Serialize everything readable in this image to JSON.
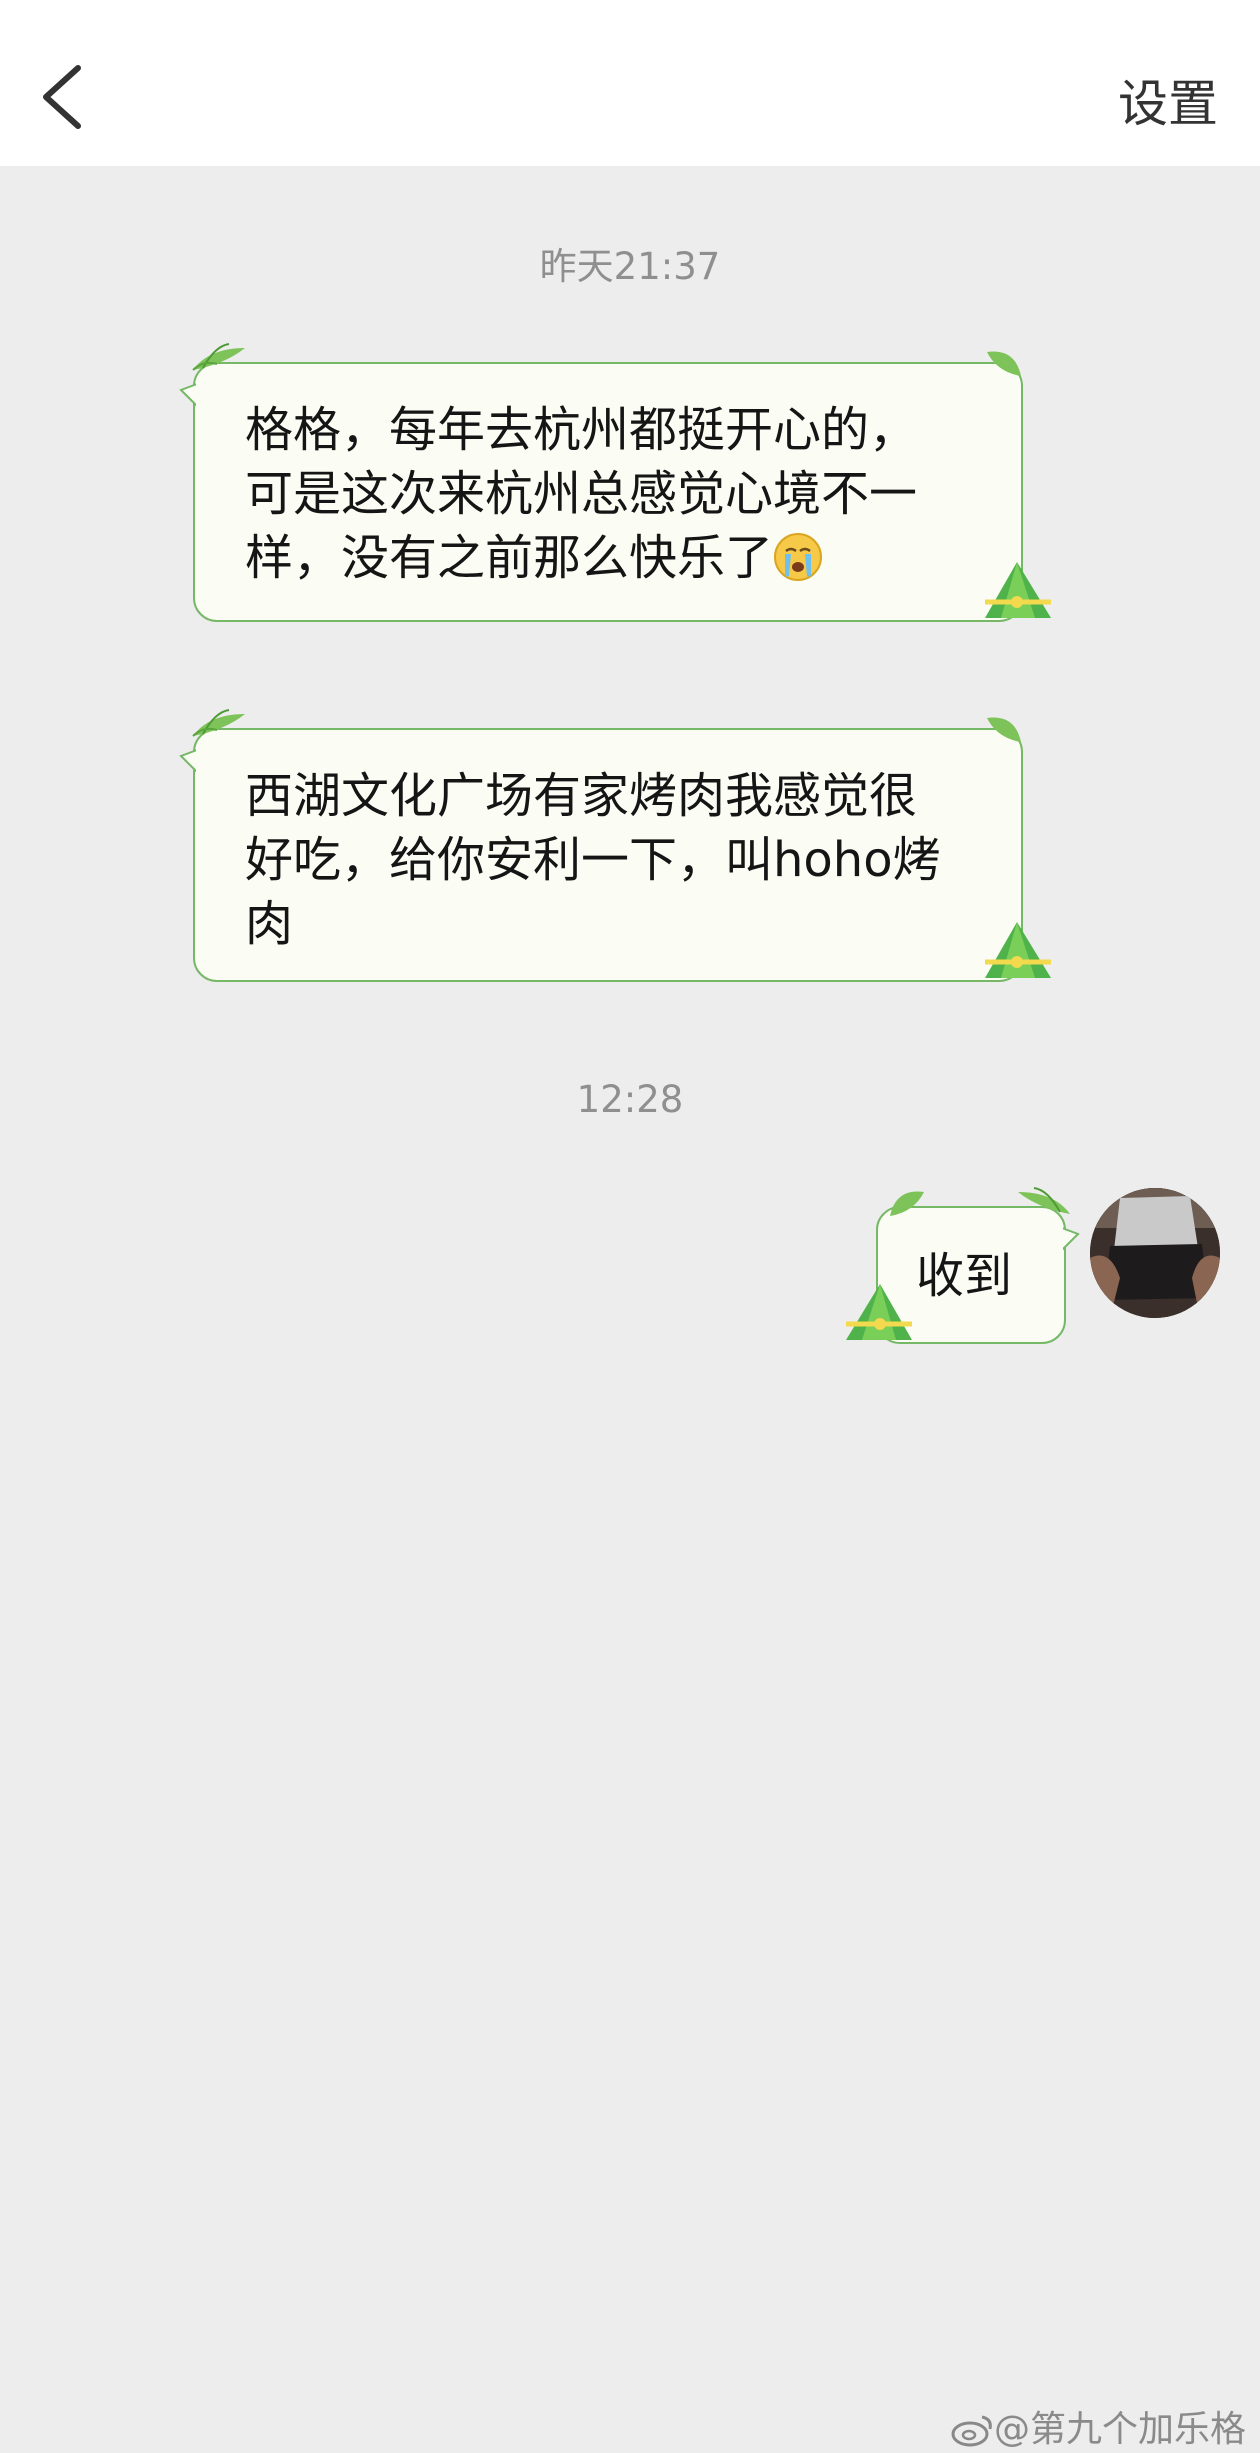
{
  "header": {
    "back_icon": "chevron-left-icon",
    "title": "",
    "settings_label": "设置"
  },
  "messages": {
    "timestamp_1": "昨天21:37",
    "msg1": {
      "line1": "格格，每年去杭州都挺开心的，",
      "line2": "可是这次来杭州总感觉心境不一",
      "line3": "样，没有之前那么快乐了",
      "emoji": "crying-face-icon"
    },
    "msg2": {
      "line1": "西湖文化广场有家烤肉我感觉很",
      "line2": "好吃，给你安利一下，叫hoho烤",
      "line3": "肉"
    },
    "timestamp_2": "12:28",
    "msg3": {
      "text": "收到"
    }
  },
  "watermark": {
    "text": "@第九个加乐格",
    "icon": "weibo-icon"
  },
  "colors": {
    "background": "#ededed",
    "header_bg": "#ffffff",
    "bubble_bg": "#fbfdf5",
    "bubble_border": "#75b866",
    "timestamp": "#8f8f8f"
  }
}
